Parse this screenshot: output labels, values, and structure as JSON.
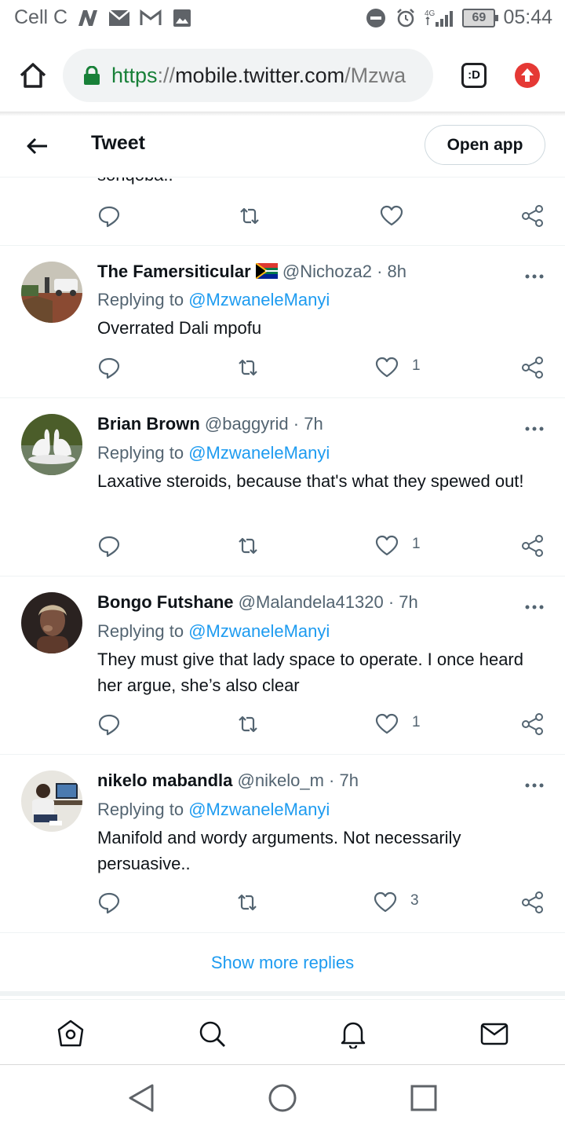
{
  "status_bar": {
    "carrier": "Cell C",
    "network": "4G",
    "battery": "69",
    "time": "05:44"
  },
  "browser": {
    "url_scheme": "https",
    "url_separator": "://",
    "url_host": "mobile.twitter.com",
    "url_path": "/Mzwa",
    "tabs_label": ":D"
  },
  "header": {
    "title": "Tweet",
    "open_app_label": "Open app"
  },
  "partial_tweet": {
    "text": "sonqoba.."
  },
  "tweets": [
    {
      "name": "The Famersiticular",
      "flag": "🇿🇦",
      "handle": "@Nichoza2",
      "time": "· 8h",
      "reply_prefix": "Replying to",
      "reply_to": "@MzwaneleManyi",
      "text": "Overrated Dali mpofu",
      "likes": "1"
    },
    {
      "name": "Brian Brown",
      "handle": "@baggyrid",
      "time": "· 7h",
      "reply_prefix": "Replying to",
      "reply_to": "@MzwaneleManyi",
      "text": "Laxative steroids, because that's what they spewed out!",
      "likes": "1"
    },
    {
      "name": "Bongo Futshane",
      "handle": "@Malandela41320",
      "time": "· 7h",
      "reply_prefix": "Replying to",
      "reply_to": "@MzwaneleManyi",
      "text": "They must give that lady space to operate. I once heard her argue, she’s also clear",
      "likes": "1"
    },
    {
      "name": "nikelo mabandla",
      "handle": "@nikelo_m",
      "time": "· 7h",
      "reply_prefix": "Replying to",
      "reply_to": "@MzwaneleManyi",
      "text": "Manifold and wordy arguments. Not necessarily persuasive..",
      "likes": "3"
    }
  ],
  "show_more": "Show more replies",
  "colors": {
    "link": "#1d9bf0",
    "secondary_text": "#536471",
    "secure_green": "#188038",
    "upload_red": "#e53935"
  },
  "icons": {
    "bottom_tabs": [
      "home-icon",
      "search-icon",
      "notifications-bell-icon",
      "messages-envelope-icon"
    ],
    "android_nav": [
      "back-triangle-icon",
      "home-circle-icon",
      "recents-square-icon"
    ]
  }
}
